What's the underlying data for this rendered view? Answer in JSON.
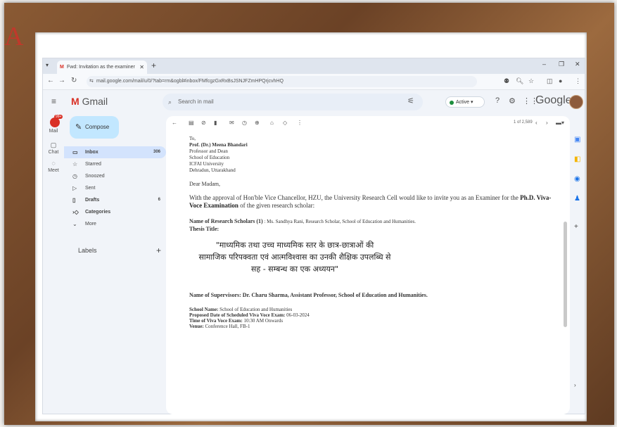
{
  "browser": {
    "tab_title": "Fwd: Invitation as the examiner",
    "url": "mail.google.com/mail/u/0/?tab=rm&ogbl#inbox/FMfcgzGxRxBsJSNJFZmHPQrjcvhHQ"
  },
  "gmail": {
    "brand": "Gmail",
    "search_placeholder": "Search in mail",
    "status": "Active",
    "google": "Google",
    "compose": "Compose",
    "labels": "Labels",
    "rail": [
      {
        "label": "Mail"
      },
      {
        "label": "Chat"
      },
      {
        "label": "Meet"
      }
    ],
    "nav": [
      {
        "label": "Inbox",
        "count": "306"
      },
      {
        "label": "Starred",
        "count": ""
      },
      {
        "label": "Snoozed",
        "count": ""
      },
      {
        "label": "Sent",
        "count": ""
      },
      {
        "label": "Drafts",
        "count": "6"
      },
      {
        "label": "Categories",
        "count": ""
      },
      {
        "label": "More",
        "count": ""
      }
    ],
    "pager": "1 of 2,589"
  },
  "email": {
    "to_lines": [
      "To,",
      "Prof. (Dr.) Meena Bhandari",
      "Professor and Dean",
      "School of Education",
      "ICFAI University",
      "Dehradun, Uttarakhand"
    ],
    "greeting": "Dear Madam,",
    "body_prefix": "With the approval of Hon'ble Vice Chancellor, HZU, the University Research Cell would like to invite you as an Examiner for the",
    "body_bold": "Ph.D. Viva-Voce Examination",
    "body_suffix": "of the given research scholar:",
    "scholar_label": "Name of Research Scholars (1)",
    "scholar_value": ": Ms. Sandhya Rani, Research Scholar, School of Education and Humanities.",
    "thesis_title_label": "Thesis Title:",
    "thesis_title_lines": [
      "\"माध्यमिक तथा उच्च माध्यमिक स्तर के छात्र-छात्राओं की",
      "सामाजिक परिपक्वता एवं आत्मविश्वास का उनकी शैक्षिक उपलब्धि से",
      "सह - सम्बन्ध का एक अध्ययन\""
    ],
    "supervisors": "Name of Supervisors: Dr. Charu Sharma, Assistant Professor, School of Education and Humanities.",
    "school_label": "School Name:",
    "school_value": "School of Education and Humanities",
    "date_label": "Proposed Date of Scheduled Viva Voce Exam:",
    "date_value": "06-03-2024",
    "time_label": "Time of Viva Voce Exam:",
    "time_value": "10:30 AM Onwards",
    "venue_label": "Venue:",
    "venue_value": "Conference Hall, FB-1"
  }
}
